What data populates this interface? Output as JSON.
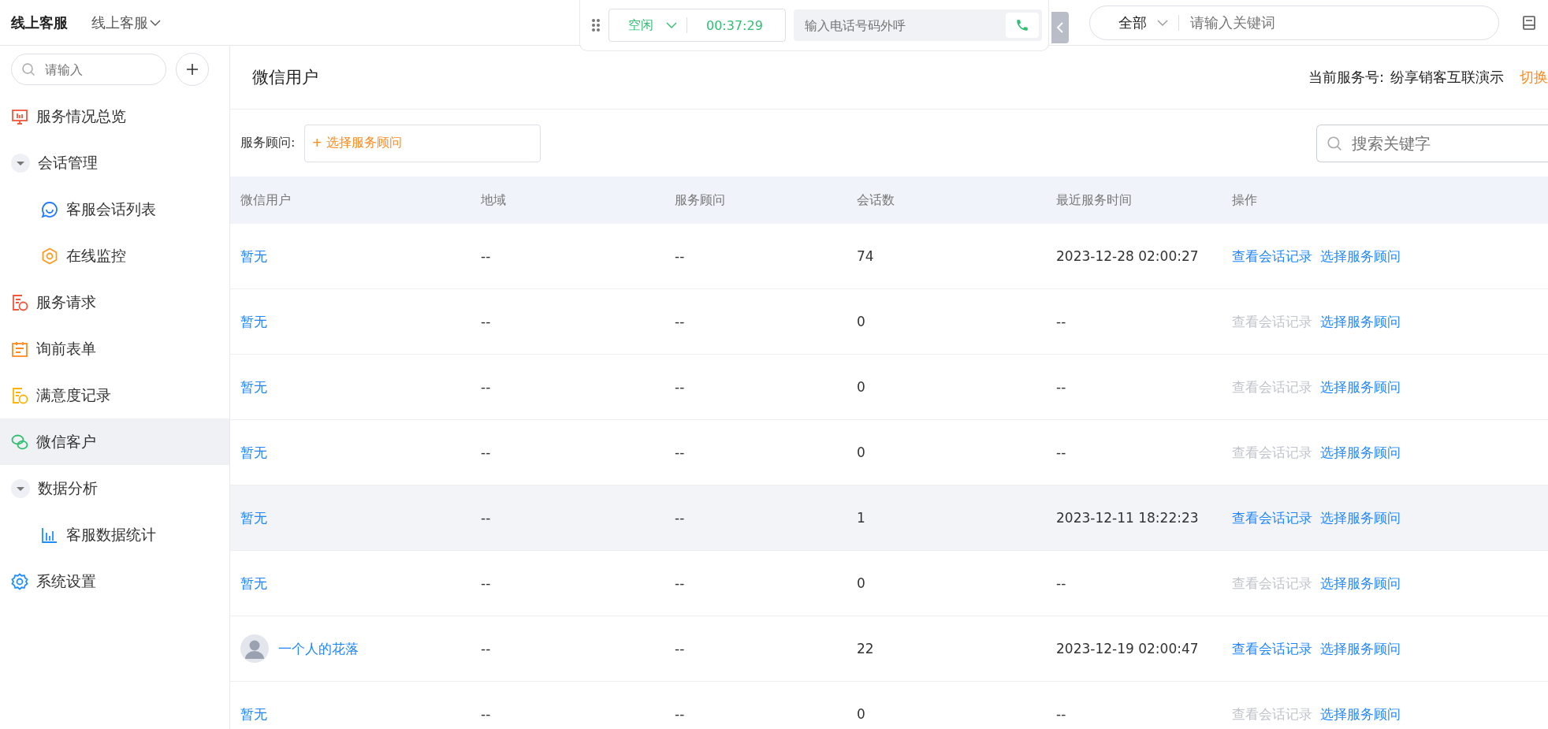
{
  "header": {
    "brand": "线上客服",
    "menu": "线上客服"
  },
  "call_panel": {
    "status": "空闲",
    "timer": "00:37:29",
    "phone_placeholder": "输入电话号码外呼"
  },
  "global_search": {
    "scope": "全部",
    "placeholder": "请输入关键词"
  },
  "sidebar": {
    "search_placeholder": "请输入",
    "items": [
      {
        "label": "服务情况总览",
        "kind": "item",
        "selected": false
      },
      {
        "label": "会话管理",
        "kind": "group",
        "expanded": true,
        "selected": false,
        "children": [
          {
            "label": "客服会话列表",
            "selected": false
          },
          {
            "label": "在线监控",
            "selected": false
          }
        ]
      },
      {
        "label": "服务请求",
        "kind": "item",
        "selected": false
      },
      {
        "label": "询前表单",
        "kind": "item",
        "selected": false
      },
      {
        "label": "满意度记录",
        "kind": "item",
        "selected": false
      },
      {
        "label": "微信客户",
        "kind": "item",
        "selected": true
      },
      {
        "label": "数据分析",
        "kind": "group",
        "expanded": true,
        "selected": false,
        "children": [
          {
            "label": "客服数据统计",
            "selected": false
          }
        ]
      },
      {
        "label": "系统设置",
        "kind": "item",
        "selected": false
      }
    ]
  },
  "page": {
    "title": "微信用户",
    "service_label": "当前服务号:",
    "service_name": "纷享销客互联演示",
    "switch_link": "切换"
  },
  "filter": {
    "label": "服务顾问:",
    "select_text": "+ 选择服务顾问",
    "search_placeholder": "搜索关键字"
  },
  "table": {
    "columns": [
      "微信用户",
      "地域",
      "服务顾问",
      "会话数",
      "最近服务时间",
      "操作"
    ],
    "rows": [
      {
        "user": "暂无",
        "avatar": false,
        "region": "--",
        "advisor": "--",
        "sessions": "74",
        "last_time": "2023-12-28 02:00:27",
        "view": "查看会话记录",
        "view_disabled": false,
        "assign": "选择服务顾问",
        "highlighted": false
      },
      {
        "user": "暂无",
        "avatar": false,
        "region": "--",
        "advisor": "--",
        "sessions": "0",
        "last_time": "--",
        "view": "查看会话记录",
        "view_disabled": true,
        "assign": "选择服务顾问",
        "highlighted": false
      },
      {
        "user": "暂无",
        "avatar": false,
        "region": "--",
        "advisor": "--",
        "sessions": "0",
        "last_time": "--",
        "view": "查看会话记录",
        "view_disabled": true,
        "assign": "选择服务顾问",
        "highlighted": false
      },
      {
        "user": "暂无",
        "avatar": false,
        "region": "--",
        "advisor": "--",
        "sessions": "0",
        "last_time": "--",
        "view": "查看会话记录",
        "view_disabled": true,
        "assign": "选择服务顾问",
        "highlighted": false
      },
      {
        "user": "暂无",
        "avatar": false,
        "region": "--",
        "advisor": "--",
        "sessions": "1",
        "last_time": "2023-12-11 18:22:23",
        "view": "查看会话记录",
        "view_disabled": false,
        "assign": "选择服务顾问",
        "highlighted": true
      },
      {
        "user": "暂无",
        "avatar": false,
        "region": "--",
        "advisor": "--",
        "sessions": "0",
        "last_time": "--",
        "view": "查看会话记录",
        "view_disabled": true,
        "assign": "选择服务顾问",
        "highlighted": false
      },
      {
        "user": "一个人的花落",
        "avatar": true,
        "region": "--",
        "advisor": "--",
        "sessions": "22",
        "last_time": "2023-12-19 02:00:47",
        "view": "查看会话记录",
        "view_disabled": false,
        "assign": "选择服务顾问",
        "highlighted": false
      },
      {
        "user": "暂无",
        "avatar": false,
        "region": "--",
        "advisor": "--",
        "sessions": "0",
        "last_time": "--",
        "view": "查看会话记录",
        "view_disabled": true,
        "assign": "选择服务顾问",
        "highlighted": false
      }
    ]
  }
}
